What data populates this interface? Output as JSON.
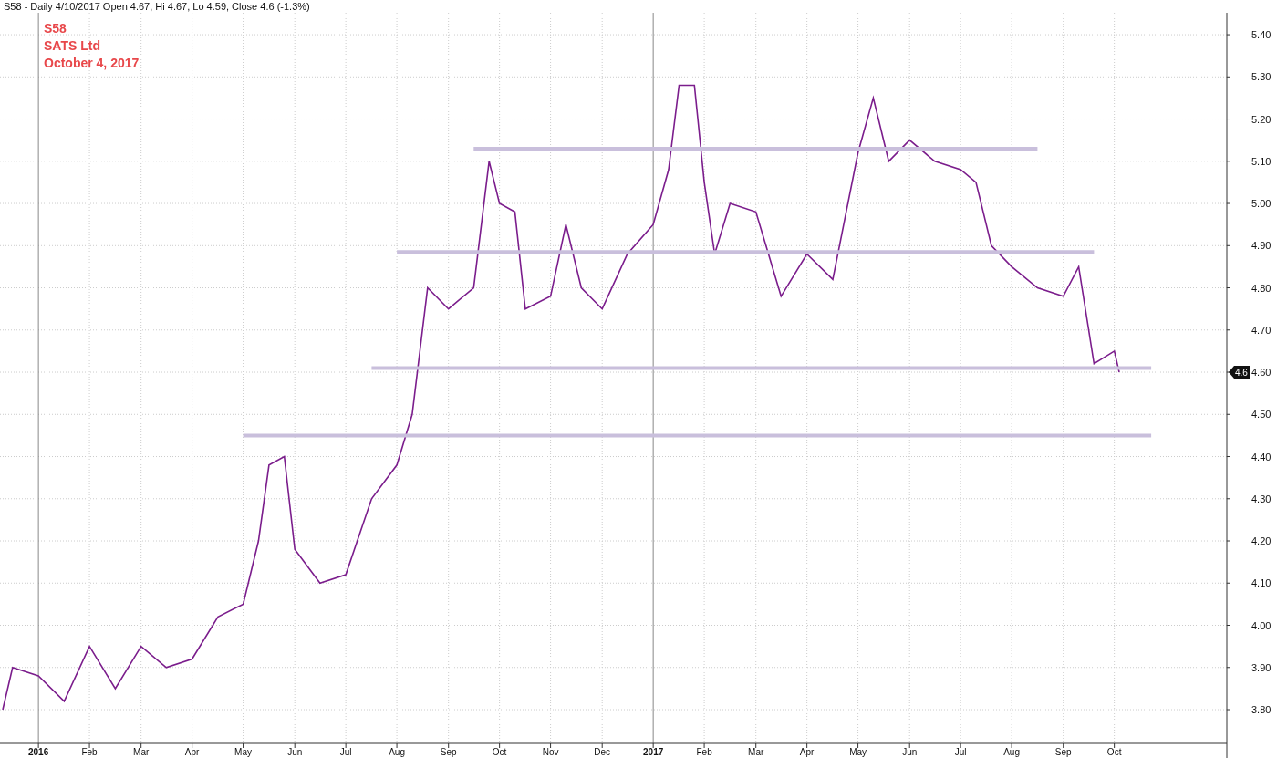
{
  "header": "S58 - Daily 4/10/2017 Open 4.67, Hi 4.67, Lo 4.59, Close 4.6 (-1.3%)",
  "chart": {
    "legend": [
      "SATS Ltd",
      "October 4, 2017"
    ],
    "last_price": {
      "label": "4.6"
    },
    "chart_data": {
      "type": "line",
      "x": [
        2015.942,
        2015.958,
        2016,
        2016.042,
        2016.083,
        2016.125,
        2016.167,
        2016.208,
        2016.25,
        2016.292,
        2016.333,
        2016.358,
        2016.375,
        2016.4,
        2016.417,
        2016.458,
        2016.5,
        2016.542,
        2016.583,
        2016.608,
        2016.633,
        2016.667,
        2016.708,
        2016.733,
        2016.75,
        2016.775,
        2016.792,
        2016.833,
        2016.858,
        2016.883,
        2016.917,
        2016.958,
        2017,
        2017.025,
        2017.042,
        2017.067,
        2017.083,
        2017.1,
        2017.125,
        2017.167,
        2017.208,
        2017.25,
        2017.292,
        2017.333,
        2017.358,
        2017.383,
        2017.417,
        2017.458,
        2017.5,
        2017.525,
        2017.55,
        2017.583,
        2017.625,
        2017.667,
        2017.692,
        2017.717,
        2017.75,
        2017.758,
        2017.81
      ],
      "series": [
        {
          "name": "S58",
          "color": "#7b1d8c",
          "values": [
            3.8,
            3.9,
            3.88,
            3.82,
            3.95,
            3.85,
            3.95,
            3.9,
            3.92,
            4.02,
            4.05,
            4.2,
            4.38,
            4.4,
            4.18,
            4.1,
            4.12,
            4.3,
            4.38,
            4.5,
            4.8,
            4.75,
            4.8,
            5.1,
            5.0,
            4.98,
            4.75,
            4.78,
            4.95,
            4.8,
            4.75,
            4.88,
            4.95,
            5.08,
            5.28,
            5.28,
            5.05,
            4.88,
            5.0,
            4.98,
            4.78,
            4.88,
            4.82,
            5.12,
            5.25,
            5.1,
            5.15,
            5.1,
            5.08,
            5.05,
            4.9,
            4.85,
            4.8,
            4.78,
            4.85,
            4.62,
            4.65,
            4.6,
            null
          ]
        },
        {
          "color": "#c9bfdc",
          "values": [
            null,
            null,
            null,
            null,
            null,
            null,
            null,
            null,
            null,
            null,
            null,
            null,
            null,
            null,
            null,
            null,
            null,
            null,
            null,
            null,
            null,
            null,
            5.13,
            5.13,
            5.13,
            5.13,
            5.13,
            5.13,
            5.13,
            5.13,
            5.13,
            5.13,
            5.13,
            5.13,
            5.13,
            5.13,
            5.13,
            5.13,
            5.13,
            5.13,
            5.13,
            5.13,
            5.13,
            5.13,
            5.13,
            5.13,
            5.13,
            5.13,
            5.13,
            5.13,
            5.13,
            5.13,
            5.13,
            null,
            null,
            null,
            null,
            null,
            null
          ]
        },
        {
          "color": "#c9bfdc",
          "values": [
            null,
            null,
            null,
            null,
            null,
            null,
            null,
            null,
            null,
            null,
            null,
            null,
            null,
            null,
            null,
            null,
            null,
            null,
            4.885,
            4.885,
            4.885,
            4.885,
            4.885,
            4.885,
            4.885,
            4.885,
            4.885,
            4.885,
            4.885,
            4.885,
            4.885,
            4.885,
            4.885,
            4.885,
            4.885,
            4.885,
            4.885,
            4.885,
            4.885,
            4.885,
            4.885,
            4.885,
            4.885,
            4.885,
            4.885,
            4.885,
            4.885,
            4.885,
            4.885,
            4.885,
            4.885,
            4.885,
            4.885,
            4.885,
            4.885,
            4.885,
            null,
            null,
            null
          ]
        },
        {
          "color": "#c9bfdc",
          "values": [
            null,
            null,
            null,
            null,
            null,
            null,
            null,
            null,
            null,
            null,
            null,
            null,
            null,
            null,
            null,
            null,
            null,
            4.61,
            4.61,
            4.61,
            4.61,
            4.61,
            4.61,
            4.61,
            4.61,
            4.61,
            4.61,
            4.61,
            4.61,
            4.61,
            4.61,
            4.61,
            4.61,
            4.61,
            4.61,
            4.61,
            4.61,
            4.61,
            4.61,
            4.61,
            4.61,
            4.61,
            4.61,
            4.61,
            4.61,
            4.61,
            4.61,
            4.61,
            4.61,
            4.61,
            4.61,
            4.61,
            4.61,
            4.61,
            4.61,
            4.61,
            4.61,
            4.61,
            4.61
          ]
        },
        {
          "color": "#c9bfdc",
          "values": [
            null,
            null,
            null,
            null,
            null,
            null,
            null,
            null,
            null,
            null,
            4.45,
            4.45,
            4.45,
            4.45,
            4.45,
            4.45,
            4.45,
            4.45,
            4.45,
            4.45,
            4.45,
            4.45,
            4.45,
            4.45,
            4.45,
            4.45,
            4.45,
            4.45,
            4.45,
            4.45,
            4.45,
            4.45,
            4.45,
            4.45,
            4.45,
            4.45,
            4.45,
            4.45,
            4.45,
            4.45,
            4.45,
            4.45,
            4.45,
            4.45,
            4.45,
            4.45,
            4.45,
            4.45,
            4.45,
            4.45,
            4.45,
            4.45,
            4.45,
            4.45,
            4.45,
            4.45,
            4.45,
            4.45,
            4.45
          ]
        }
      ],
      "xlim": [
        2015.9375,
        2017.933
      ],
      "ylim": [
        3.72,
        5.452
      ],
      "xticks": [
        {
          "value": 2016,
          "label": "2016"
        },
        {
          "value": 2016.083,
          "label": "Feb"
        },
        {
          "value": 2016.167,
          "label": "Mar"
        },
        {
          "value": 2016.25,
          "label": "Apr"
        },
        {
          "value": 2016.333,
          "label": "May"
        },
        {
          "value": 2016.417,
          "label": "Jun"
        },
        {
          "value": 2016.5,
          "label": "Jul"
        },
        {
          "value": 2016.583,
          "label": "Aug"
        },
        {
          "value": 2016.667,
          "label": "Sep"
        },
        {
          "value": 2016.75,
          "label": "Oct"
        },
        {
          "value": 2016.833,
          "label": "Nov"
        },
        {
          "value": 2016.917,
          "label": "Dec"
        },
        {
          "value": 2017,
          "label": "2017"
        },
        {
          "value": 2017.083,
          "label": "Feb"
        },
        {
          "value": 2017.167,
          "label": "Mar"
        },
        {
          "value": 2017.25,
          "label": "Apr"
        },
        {
          "value": 2017.333,
          "label": "May"
        },
        {
          "value": 2017.417,
          "label": "Jun"
        },
        {
          "value": 2017.5,
          "label": "Jul"
        },
        {
          "value": 2017.583,
          "label": "Aug"
        },
        {
          "value": 2017.667,
          "label": "Sep"
        },
        {
          "value": 2017.75,
          "label": "Oct"
        }
      ],
      "yticks": [
        {
          "value": 3.8,
          "label": "3.80"
        },
        {
          "value": 3.9,
          "label": "3.90"
        },
        {
          "value": 4.0,
          "label": "4.00"
        },
        {
          "value": 4.1,
          "label": "4.10"
        },
        {
          "value": 4.2,
          "label": "4.20"
        },
        {
          "value": 4.3,
          "label": "4.30"
        },
        {
          "value": 4.4,
          "label": "4.40"
        },
        {
          "value": 4.5,
          "label": "4.50"
        },
        {
          "value": 4.6,
          "label": "4.60"
        },
        {
          "value": 4.7,
          "label": "4.70"
        },
        {
          "value": 4.8,
          "label": "4.80"
        },
        {
          "value": 4.9,
          "label": "4.90"
        },
        {
          "value": 5.0,
          "label": "5.00"
        },
        {
          "value": 5.1,
          "label": "5.10"
        },
        {
          "value": 5.2,
          "label": "5.20"
        },
        {
          "value": 5.3,
          "label": "5.30"
        },
        {
          "value": 5.4,
          "label": "5.40"
        }
      ],
      "grid": true,
      "ref_lines": [
        {
          "axis": "x",
          "value": 2016,
          "color": "#888888"
        },
        {
          "axis": "x",
          "value": 2017,
          "color": "#888888"
        }
      ]
    }
  }
}
